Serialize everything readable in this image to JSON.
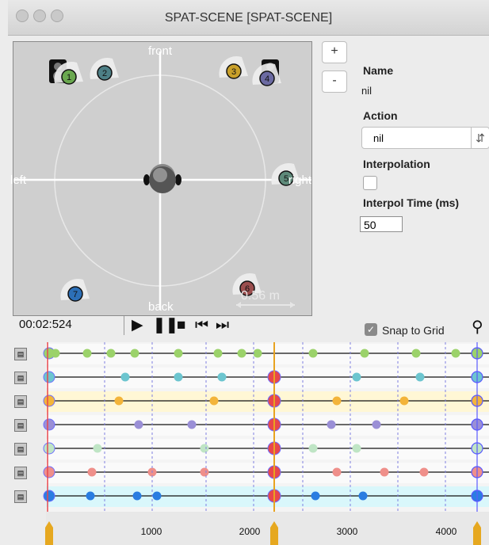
{
  "window": {
    "title": "SPAT-SCENE [SPAT-SCENE]"
  },
  "scene": {
    "labels": {
      "front": "front",
      "back": "back",
      "left": "left",
      "right": "right",
      "scale": "0.56 m"
    },
    "sources": [
      {
        "id": "1",
        "color": "#6aa84f"
      },
      {
        "id": "2",
        "color": "#4d7f86"
      },
      {
        "id": "3",
        "color": "#c9a02a"
      },
      {
        "id": "4",
        "color": "#6b6aa2"
      },
      {
        "id": "5",
        "color": "#5e8a7a"
      },
      {
        "id": "6",
        "color": "#9b4e4e"
      },
      {
        "id": "7",
        "color": "#2c6fb7"
      }
    ],
    "icons": [
      "speaker-icon",
      "speaker-icon",
      "listener-head-icon"
    ]
  },
  "buttons": {
    "add": "+",
    "remove": "-"
  },
  "props": {
    "name_label": "Name",
    "name_value": "nil",
    "action_label": "Action",
    "action_value": "nil",
    "interp_label": "Interpolation",
    "interp_checked": false,
    "interp_time_label": "Interpol Time (ms)",
    "interp_time_value": "50"
  },
  "transport": {
    "time": "00:02:524",
    "controls": [
      "play-icon",
      "pause-icon",
      "stop-icon",
      "prev-icon",
      "next-icon"
    ],
    "snap_label": "Snap to Grid",
    "snap_checked": true,
    "zoom_icon": "magnifier-icon"
  },
  "timeline": {
    "ticks": [
      "1000",
      "2000",
      "3000",
      "4000"
    ],
    "tracks": [
      {
        "color": "#9bd26a",
        "highlight": false,
        "points": [
          60,
          100,
          130,
          160,
          215,
          265,
          295,
          315,
          385,
          450,
          515,
          565
        ]
      },
      {
        "color": "#6cc5cf",
        "highlight": false,
        "points": [
          148,
          215,
          270,
          440,
          520
        ]
      },
      {
        "color": "#f3b43a",
        "highlight": true,
        "points": [
          140,
          260,
          415,
          500
        ]
      },
      {
        "color": "#9a8fd6",
        "highlight": false,
        "points": [
          165,
          232,
          408,
          465
        ]
      },
      {
        "color": "#bfe5c5",
        "highlight": false,
        "points": [
          113,
          248,
          385,
          440
        ]
      },
      {
        "color": "#ef8f8a",
        "highlight": false,
        "points": [
          106,
          182,
          248,
          415,
          475,
          525
        ]
      },
      {
        "color": "#2a7de1",
        "highlight": true,
        "points": [
          104,
          163,
          188,
          388,
          448
        ]
      }
    ]
  }
}
